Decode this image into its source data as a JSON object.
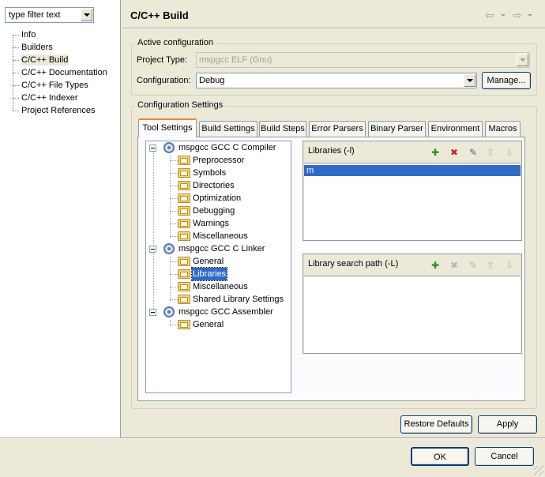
{
  "left_pane": {
    "filter_text": "type filter text",
    "nav_items": [
      "Info",
      "Builders",
      "C/C++ Build",
      "C/C++ Documentation",
      "C/C++ File Types",
      "C/C++ Indexer",
      "Project References"
    ],
    "selected_index": 2
  },
  "header": {
    "title": "C/C++ Build"
  },
  "active_config": {
    "group_title": "Active configuration",
    "project_type_label": "Project Type:",
    "project_type_value": "mspgcc ELF (Gnu)",
    "configuration_label": "Configuration:",
    "configuration_value": "Debug",
    "manage_label": "Manage..."
  },
  "config_settings": {
    "group_title": "Configuration Settings",
    "tabs": [
      "Tool Settings",
      "Build Settings",
      "Build Steps",
      "Error Parsers",
      "Binary Parser",
      "Environment",
      "Macros"
    ],
    "active_tab": 0
  },
  "tree": {
    "tools": [
      {
        "label": "mspgcc GCC C Compiler",
        "options": [
          "Preprocessor",
          "Symbols",
          "Directories",
          "Optimization",
          "Debugging",
          "Warnings",
          "Miscellaneous"
        ]
      },
      {
        "label": "mspgcc GCC C Linker",
        "options": [
          "General",
          "Libraries",
          "Miscellaneous",
          "Shared Library Settings"
        ]
      },
      {
        "label": "mspgcc GCC Assembler",
        "options": [
          "General"
        ]
      }
    ],
    "selected": "Libraries"
  },
  "libraries_panel": {
    "title": "Libraries (-l)",
    "items": [
      "m"
    ]
  },
  "search_path_panel": {
    "title": "Library search path (-L)",
    "items": []
  },
  "buttons": {
    "restore_defaults": "Restore Defaults",
    "apply": "Apply",
    "ok": "OK",
    "cancel": "Cancel"
  },
  "colors": {
    "selection": "#316ac5",
    "dialog_bg": "#ece9d8",
    "tab_accent": "#e68b2c"
  }
}
